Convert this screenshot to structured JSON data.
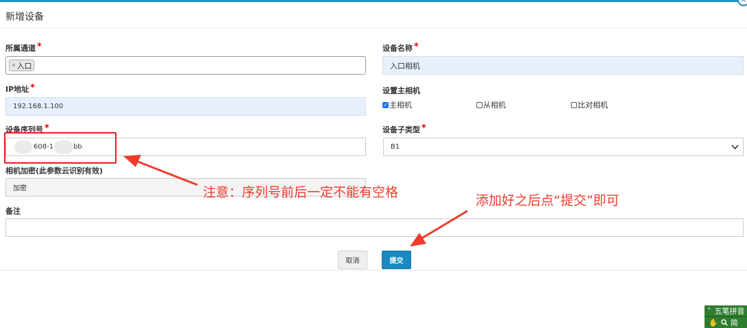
{
  "dialog": {
    "title": "新增设备"
  },
  "fields": {
    "channel": {
      "label": "所属通道",
      "required": "*",
      "tag": "入口",
      "tag_remove": "×"
    },
    "device_name": {
      "label": "设备名称",
      "required": "*",
      "value": "入口相机"
    },
    "ip": {
      "label": "IP地址",
      "required": "*",
      "value": "192.168.1.100"
    },
    "main_camera": {
      "label": "设置主相机",
      "options": [
        {
          "label": "主相机",
          "checked": true
        },
        {
          "label": "从相机",
          "checked": false
        },
        {
          "label": "比对相机",
          "checked": false
        }
      ]
    },
    "serial": {
      "label": "设备序列号",
      "required": "*",
      "value_visible_1": "608-1",
      "value_visible_2": "bb"
    },
    "subtype": {
      "label": "设备子类型",
      "required": "*",
      "value": "B1"
    },
    "encryption": {
      "label": "相机加密(此参数云识别有效)",
      "value": "加密"
    },
    "remarks": {
      "label": "备注",
      "value": ""
    }
  },
  "buttons": {
    "cancel": "取消",
    "submit": "提交"
  },
  "annotations": {
    "serial_note": "注意：序列号前后一定不能有空格",
    "submit_note": "添加好之后点“提交”即可",
    "color": "#ef3b2d"
  },
  "ime_toolbar": {
    "mode": "五笔拼音",
    "lang": "简",
    "icons": [
      "double-chevron-icon",
      "hand-icon",
      "search-icon"
    ]
  },
  "colors": {
    "accent": "#1c9cbe",
    "submit_bg": "#1989c0",
    "autofill_bg": "#e8f0fe",
    "required": "#e60000"
  }
}
